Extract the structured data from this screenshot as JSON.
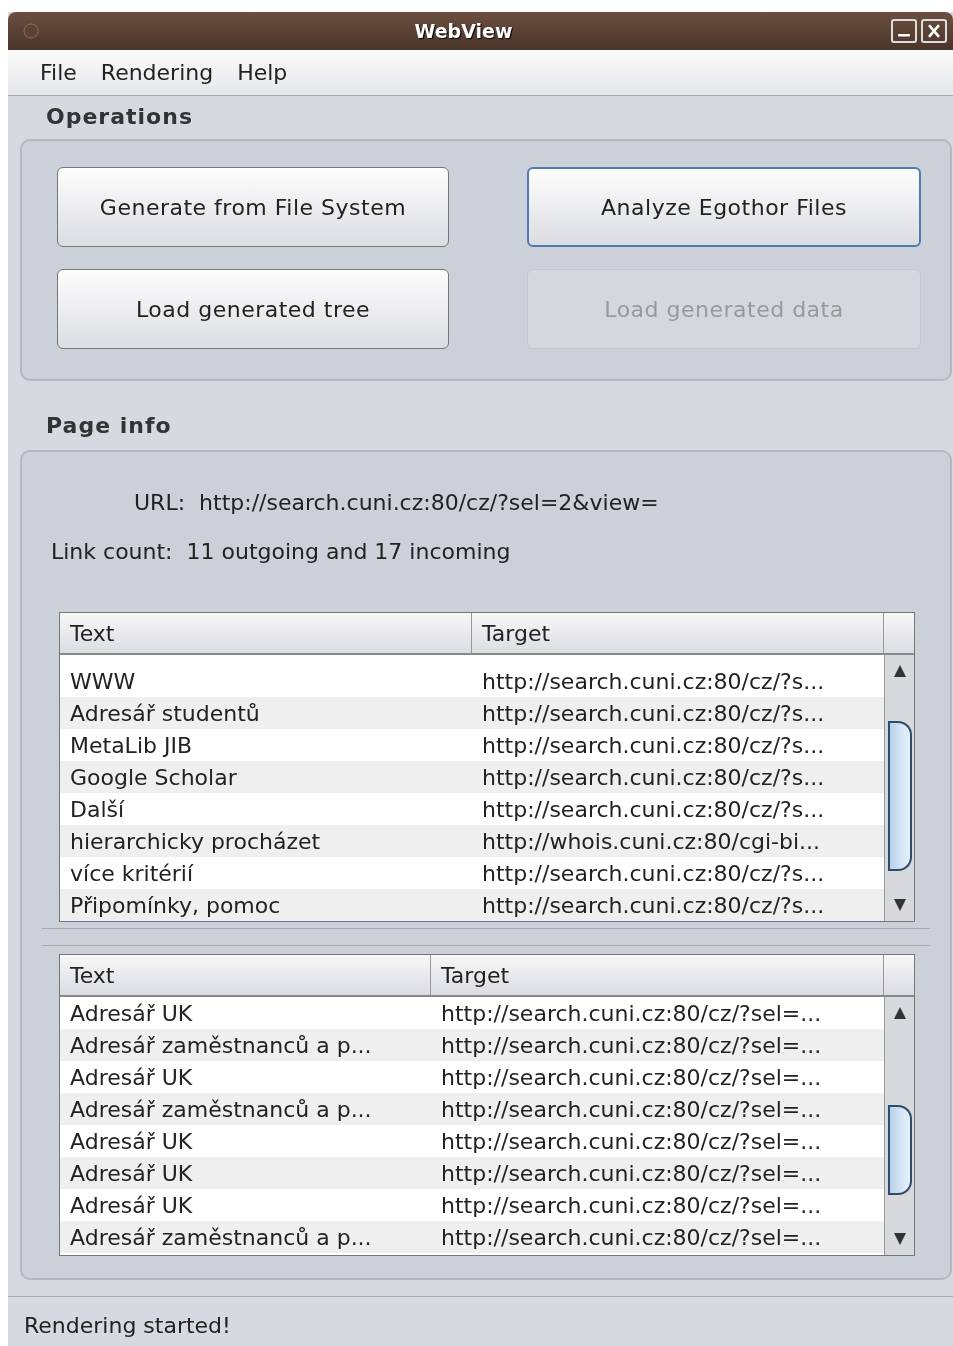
{
  "window": {
    "title": "WebView"
  },
  "menu": [
    "File",
    "Rendering",
    "Help"
  ],
  "operations": {
    "title": "Operations",
    "buttons": [
      {
        "label": "Generate from File System",
        "disabled": false,
        "focused": false
      },
      {
        "label": "Analyze Egothor Files",
        "disabled": false,
        "focused": true
      },
      {
        "label": "Load generated tree",
        "disabled": false,
        "focused": false
      },
      {
        "label": "Load generated data",
        "disabled": true,
        "focused": false
      }
    ]
  },
  "page_info": {
    "title": "Page info",
    "url_label": "URL:",
    "url": "http://search.cuni.cz:80/cz/?sel=2&view=",
    "link_count_label": "Link count:",
    "link_count": "11 outgoing and 17 incoming"
  },
  "tables": [
    {
      "columns": [
        "Text",
        "Target"
      ],
      "rows": [
        [
          "WWW",
          "http://search.cuni.cz:80/cz/?s..."
        ],
        [
          "Adresář studentů",
          "http://search.cuni.cz:80/cz/?s..."
        ],
        [
          "MetaLib JIB",
          "http://search.cuni.cz:80/cz/?s..."
        ],
        [
          "Google Scholar",
          "http://search.cuni.cz:80/cz/?s..."
        ],
        [
          "Další",
          "http://search.cuni.cz:80/cz/?s..."
        ],
        [
          "hierarchicky procházet",
          "http://whois.cuni.cz:80/cgi-bi..."
        ],
        [
          "více kritérií",
          "http://search.cuni.cz:80/cz/?s..."
        ],
        [
          "Připomínky, pomoc",
          "http://search.cuni.cz:80/cz/?s..."
        ]
      ]
    },
    {
      "columns": [
        "Text",
        "Target"
      ],
      "rows": [
        [
          "Adresář UK",
          "http://search.cuni.cz:80/cz/?sel=..."
        ],
        [
          "Adresář zaměstnanců a p...",
          "http://search.cuni.cz:80/cz/?sel=..."
        ],
        [
          "Adresář UK",
          "http://search.cuni.cz:80/cz/?sel=..."
        ],
        [
          "Adresář zaměstnanců a p...",
          "http://search.cuni.cz:80/cz/?sel=..."
        ],
        [
          "Adresář UK",
          "http://search.cuni.cz:80/cz/?sel=..."
        ],
        [
          "Adresář UK",
          "http://search.cuni.cz:80/cz/?sel=..."
        ],
        [
          "Adresář UK",
          "http://search.cuni.cz:80/cz/?sel=..."
        ],
        [
          "Adresář zaměstnanců a p...",
          "http://search.cuni.cz:80/cz/?sel=..."
        ]
      ]
    }
  ],
  "status_bar": "Rendering started!"
}
